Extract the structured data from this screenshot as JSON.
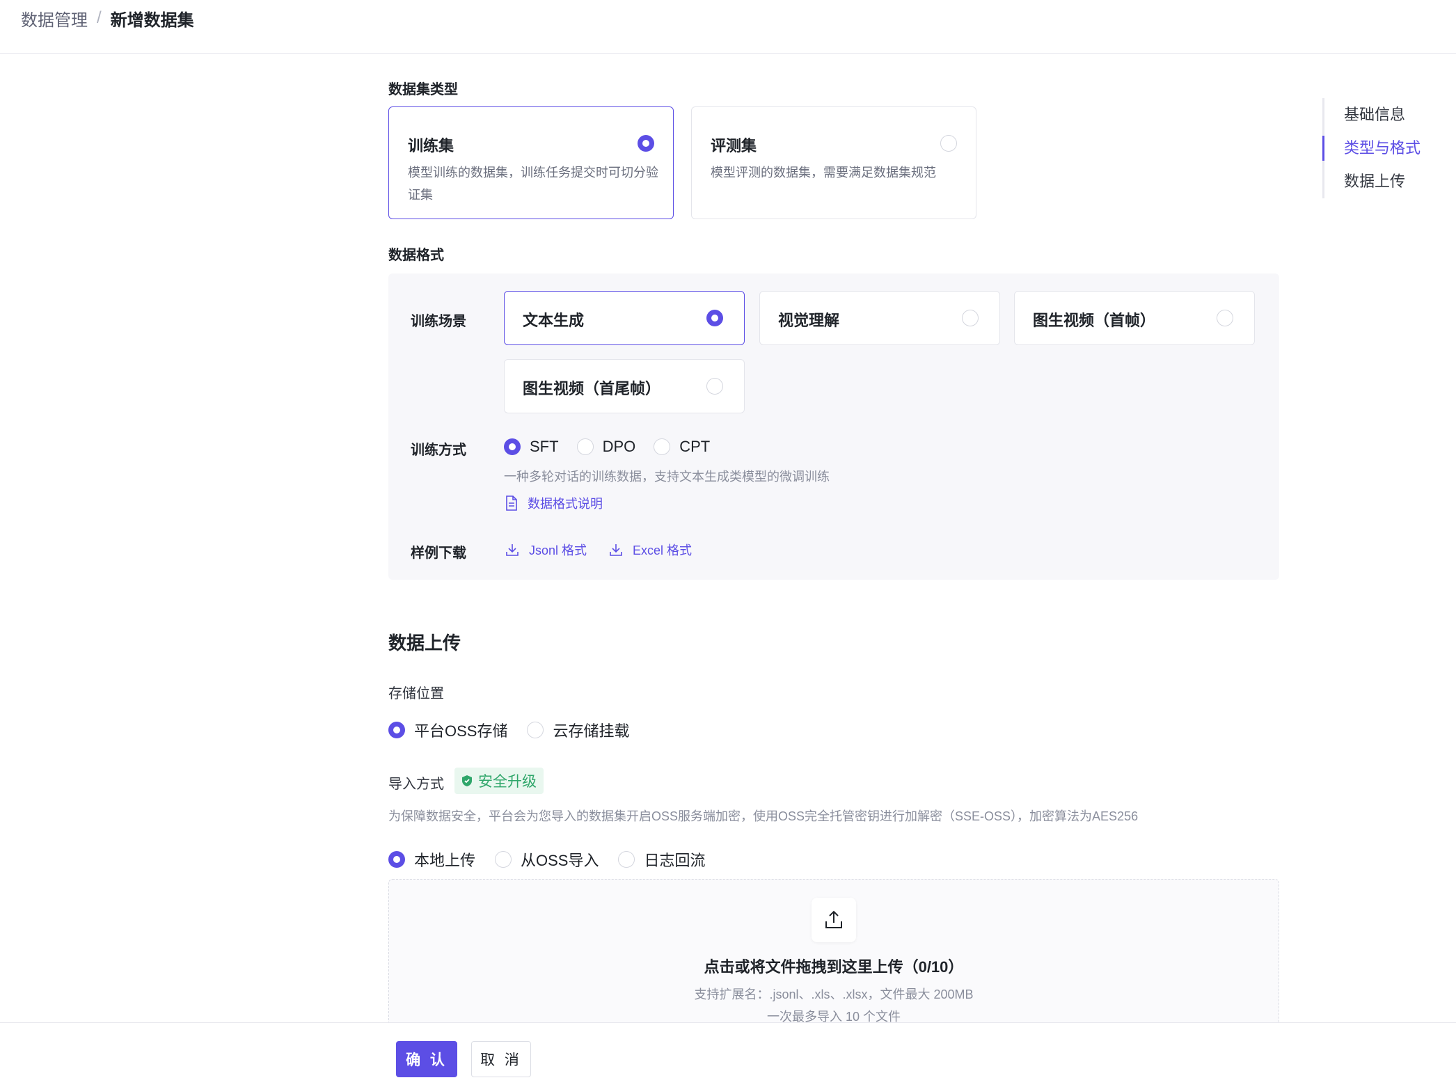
{
  "breadcrumb": {
    "parent": "数据管理",
    "separator": "/",
    "current": "新增数据集"
  },
  "anchor_nav": {
    "items": [
      "基础信息",
      "类型与格式",
      "数据上传"
    ],
    "active_index": 1
  },
  "dataset_type": {
    "label": "数据集类型",
    "options": [
      {
        "title": "训练集",
        "desc": "模型训练的数据集，训练任务提交时可切分验证集",
        "selected": true
      },
      {
        "title": "评测集",
        "desc": "模型评测的数据集，需要满足数据集规范",
        "selected": false
      }
    ]
  },
  "data_format": {
    "label": "数据格式",
    "scene_label": "训练场景",
    "scenes": [
      {
        "title": "文本生成",
        "selected": true
      },
      {
        "title": "视觉理解",
        "selected": false
      },
      {
        "title": "图生视频（首帧）",
        "selected": false
      },
      {
        "title": "图生视频（首尾帧）",
        "selected": false
      }
    ],
    "method_label": "训练方式",
    "methods": [
      {
        "label": "SFT",
        "selected": true
      },
      {
        "label": "DPO",
        "selected": false
      },
      {
        "label": "CPT",
        "selected": false
      }
    ],
    "method_hint": "一种多轮对话的训练数据，支持文本生成类模型的微调训练",
    "format_doc_link": "数据格式说明",
    "sample_label": "样例下载",
    "sample_links": [
      "Jsonl 格式",
      "Excel 格式"
    ]
  },
  "upload": {
    "section_title": "数据上传",
    "storage_label": "存储位置",
    "storage_options": [
      {
        "label": "平台OSS存储",
        "selected": true
      },
      {
        "label": "云存储挂载",
        "selected": false
      }
    ],
    "import_label": "导入方式",
    "security_tag": "安全升级",
    "security_hint": "为保障数据安全，平台会为您导入的数据集开启OSS服务端加密，使用OSS完全托管密钥进行加解密（SSE-OSS），加密算法为AES256",
    "import_options": [
      {
        "label": "本地上传",
        "selected": true
      },
      {
        "label": "从OSS导入",
        "selected": false
      },
      {
        "label": "日志回流",
        "selected": false
      }
    ],
    "dropzone": {
      "title": "点击或将文件拖拽到这里上传（0/10）",
      "support": "支持扩展名：.jsonl、.xls、.xlsx，文件最大 200MB",
      "limit": "一次最多导入 10 个文件"
    }
  },
  "footer": {
    "confirm": "确 认",
    "cancel": "取 消"
  },
  "colors": {
    "accent": "#5c4ee5",
    "safe_green": "#2fa66a",
    "panel_bg": "#f7f7fa"
  },
  "icons": [
    "document-icon",
    "download-icon",
    "shield-check-icon",
    "upload-icon"
  ]
}
